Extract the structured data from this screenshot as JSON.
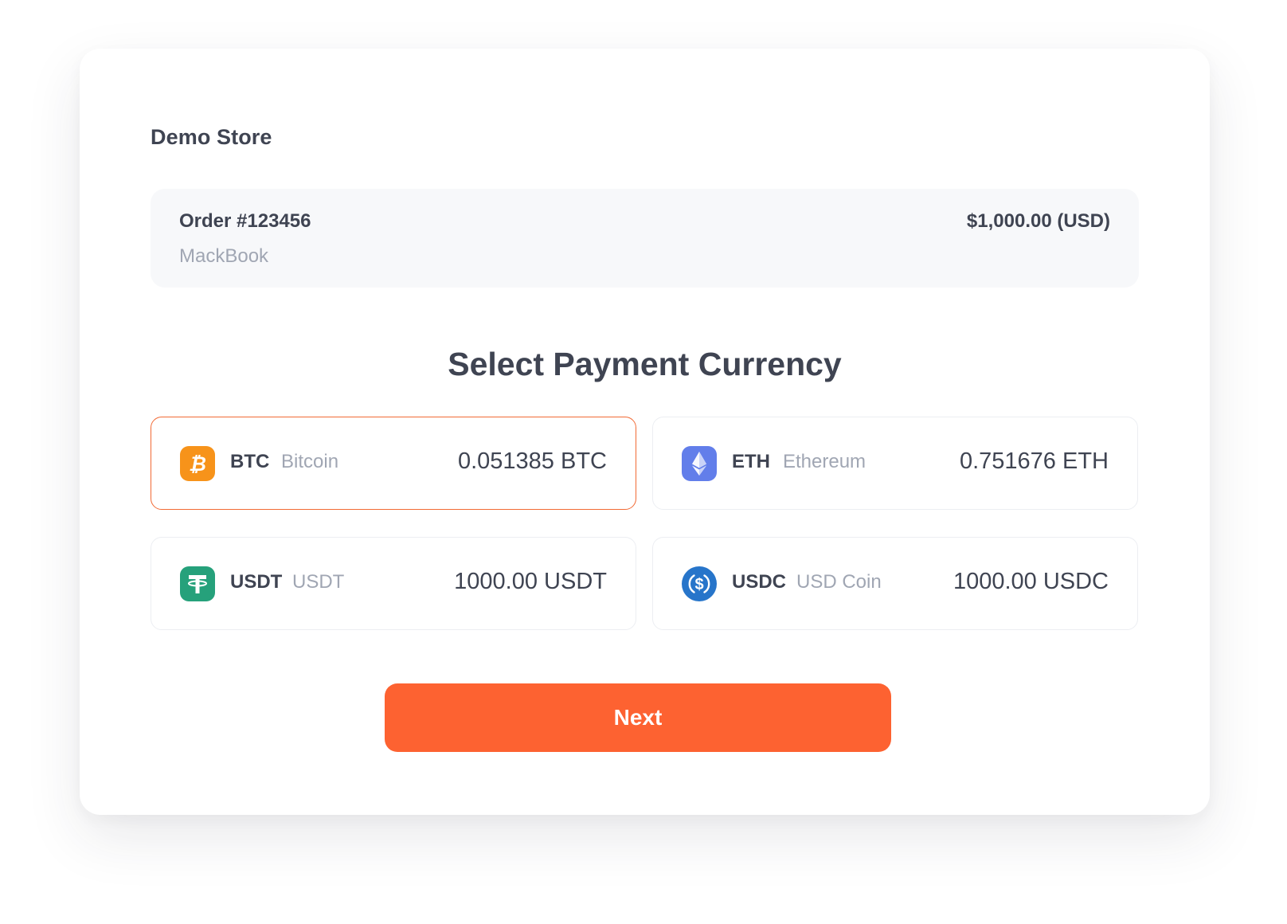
{
  "store": {
    "name": "Demo Store"
  },
  "order": {
    "number": "Order #123456",
    "item": "MackBook",
    "amount": "$1,000.00 (USD)"
  },
  "selection": {
    "title": "Select Payment Currency",
    "selected": "BTC",
    "currencies": [
      {
        "symbol": "BTC",
        "name": "Bitcoin",
        "amount": "0.051385 BTC",
        "icon": "bitcoin-icon",
        "color": "#f7931a"
      },
      {
        "symbol": "ETH",
        "name": "Ethereum",
        "amount": "0.751676 ETH",
        "icon": "ethereum-icon",
        "color": "#627eea"
      },
      {
        "symbol": "USDT",
        "name": "USDT",
        "amount": "1000.00 USDT",
        "icon": "tether-icon",
        "color": "#26a17b"
      },
      {
        "symbol": "USDC",
        "name": "USD Coin",
        "amount": "1000.00 USDC",
        "icon": "usd-coin-icon",
        "color": "#2775ca"
      }
    ]
  },
  "actions": {
    "next_label": "Next"
  },
  "theme": {
    "accent": "#fd6231",
    "selected_border": "#f26a35",
    "text_primary": "#3f4452",
    "text_secondary": "#a0a6b3",
    "panel_bg": "#f7f8fa"
  }
}
